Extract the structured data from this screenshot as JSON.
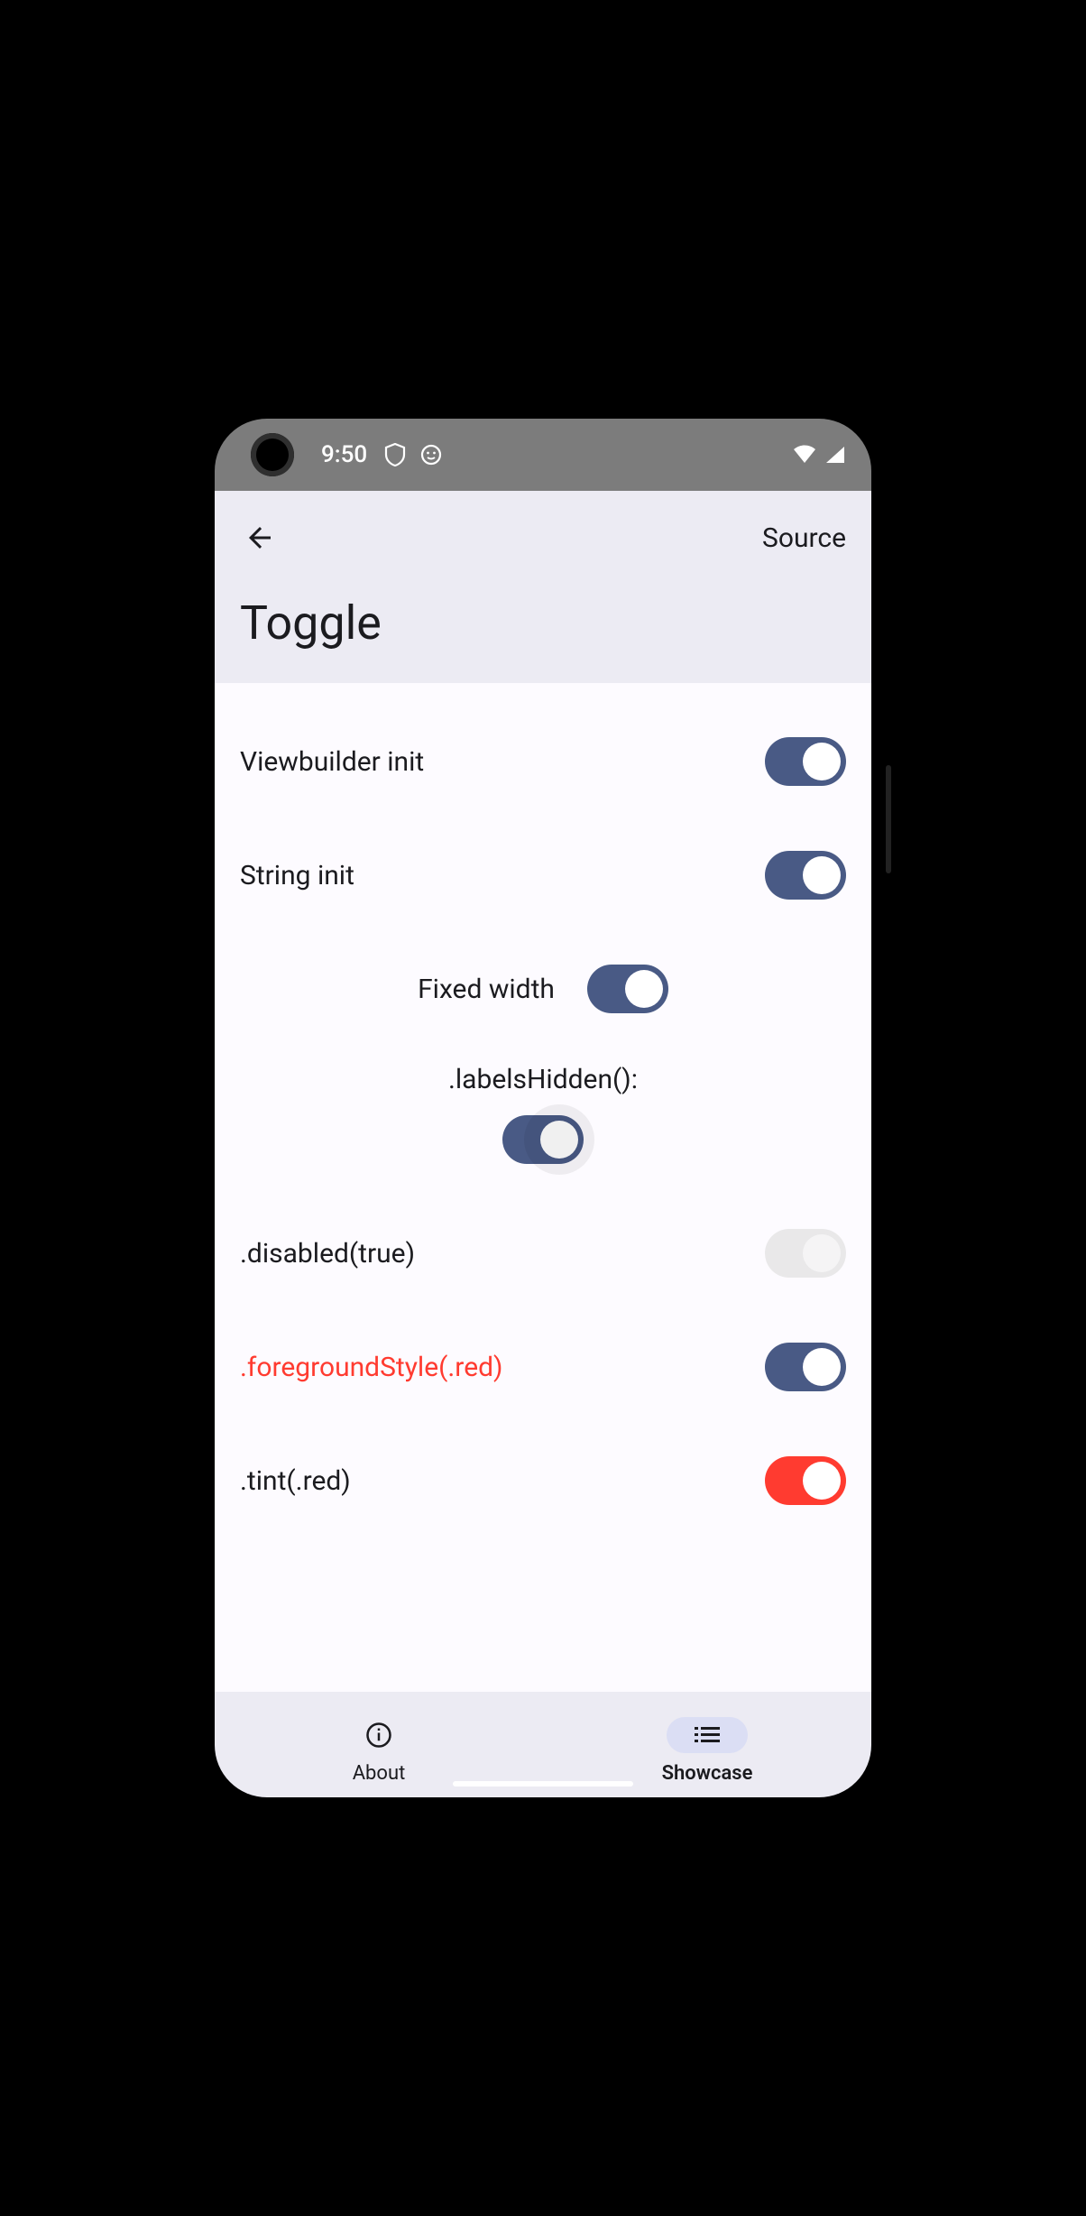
{
  "status": {
    "time": "9:50"
  },
  "header": {
    "source_label": "Source",
    "title": "Toggle"
  },
  "rows": {
    "viewbuilder": "Viewbuilder init",
    "string_init": "String init",
    "fixed_width": "Fixed width",
    "labels_hidden": ".labelsHidden():",
    "disabled": ".disabled(true)",
    "foreground_style": ".foregroundStyle(.red)",
    "tint": ".tint(.red)"
  },
  "nav": {
    "about": "About",
    "showcase": "Showcase"
  },
  "colors": {
    "switch_on": "#495a85",
    "red": "#ff3b30",
    "header_bg": "#ecebf3",
    "content_bg": "#fdfbff"
  }
}
